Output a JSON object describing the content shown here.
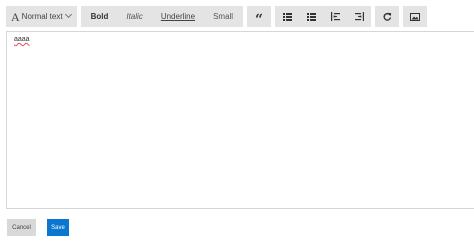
{
  "toolbar": {
    "block_style": {
      "glyph": "A",
      "label": "Normal text",
      "icon": "chevron-down-icon"
    },
    "formatting": {
      "bold": "Bold",
      "italic": "Italic",
      "underline": "Underline",
      "small": "Small"
    },
    "quote": {
      "glyph": "“",
      "icon": "quote-icon"
    },
    "list_icons": [
      "bulleted-list-icon",
      "numbered-list-icon",
      "indent-icon",
      "outdent-icon"
    ],
    "redo_icon": "redo-icon",
    "image_icon": "image-icon"
  },
  "editor": {
    "content": "aaaa"
  },
  "actions": {
    "cancel_label": "Cancel",
    "save_label": "Save"
  },
  "colors": {
    "toolbar_bg": "#e4e4e4",
    "save_button_bg": "#0b76d0",
    "cancel_button_bg": "#d9d9d9",
    "spellcheck_underline": "#e05050"
  }
}
